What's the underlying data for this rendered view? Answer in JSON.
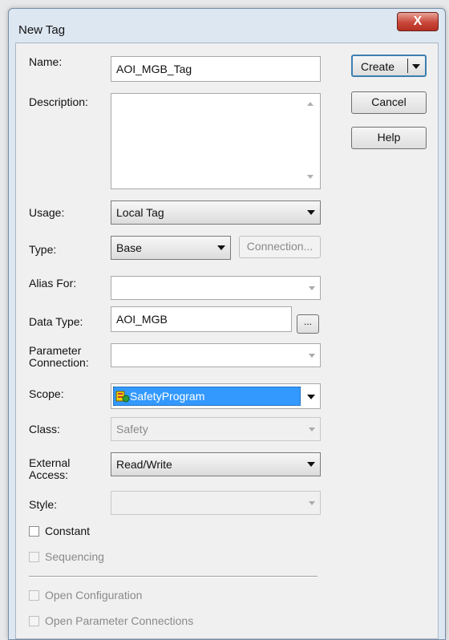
{
  "window": {
    "title": "New Tag",
    "close_glyph": "X"
  },
  "fields": {
    "name_label": "Name:",
    "name_value": "AOI_MGB_Tag",
    "description_label": "Description:",
    "description_value": "",
    "usage_label": "Usage:",
    "usage_value": "Local Tag",
    "type_label": "Type:",
    "type_value": "Base",
    "connection_button": "Connection...",
    "alias_label": "Alias For:",
    "alias_value": "",
    "datatype_label": "Data Type:",
    "datatype_value": "AOI_MGB",
    "datatype_browse": "...",
    "param_conn_label_1": "Parameter",
    "param_conn_label_2": "Connection:",
    "param_conn_value": "",
    "scope_label": "Scope:",
    "scope_value": "SafetyProgram",
    "class_label": "Class:",
    "class_value": "Safety",
    "external_access_label_1": "External",
    "external_access_label_2": "Access:",
    "external_access_value": "Read/Write",
    "style_label": "Style:",
    "style_value": ""
  },
  "checkboxes": {
    "constant": "Constant",
    "sequencing": "Sequencing",
    "open_configuration": "Open Configuration",
    "open_parameter_connections": "Open Parameter Connections"
  },
  "buttons": {
    "create": "Create",
    "cancel": "Cancel",
    "help": "Help"
  },
  "colors": {
    "scope_highlight": "#3399ff",
    "default_button_border": "#3c7fb1",
    "close_button": "#c9473a"
  }
}
